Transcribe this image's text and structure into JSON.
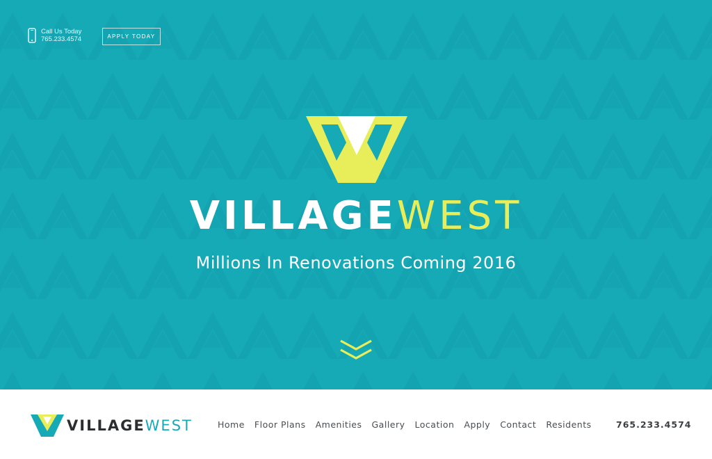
{
  "header": {
    "phone_icon": "mobile-phone-icon",
    "call_label": "Call Us Today",
    "phone": "765.233.4574",
    "apply_label": "APPLY TODAY"
  },
  "hero": {
    "logo_icon": "village-west-w-logo",
    "brand_part1": "VILLAGE",
    "brand_part2": "WEST",
    "tagline": "Millions In Renovations Coming 2016",
    "scroll_icon": "double-chevron-down-icon"
  },
  "nav": {
    "brand_part1": "VILLAGE",
    "brand_part2": "WEST",
    "links": [
      "Home",
      "Floor Plans",
      "Amenities",
      "Gallery",
      "Location",
      "Apply",
      "Contact",
      "Residents"
    ],
    "phone": "765.233.4574"
  },
  "colors": {
    "teal": "#16a9b6",
    "yellow": "#e7ee5a",
    "white": "#ffffff",
    "dark_text": "#2c2f31"
  }
}
